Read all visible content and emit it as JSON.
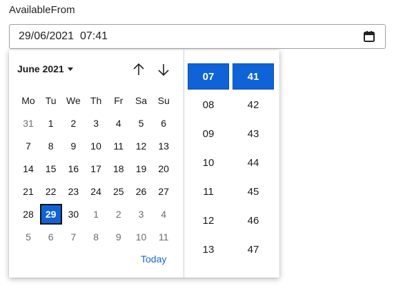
{
  "field": {
    "label": "AvailableFrom",
    "value": "29/06/2021  07:41",
    "calendar_icon": "calendar-icon"
  },
  "calendar": {
    "month_label": "June 2021",
    "nav_up_icon": "arrow-up-icon",
    "nav_down_icon": "arrow-down-icon",
    "weekdays": [
      "Mo",
      "Tu",
      "We",
      "Th",
      "Fr",
      "Sa",
      "Su"
    ],
    "weeks": [
      [
        "31",
        "1",
        "2",
        "3",
        "4",
        "5",
        "6"
      ],
      [
        "7",
        "8",
        "9",
        "10",
        "11",
        "12",
        "13"
      ],
      [
        "14",
        "15",
        "16",
        "17",
        "18",
        "19",
        "20"
      ],
      [
        "21",
        "22",
        "23",
        "24",
        "25",
        "26",
        "27"
      ],
      [
        "28",
        "29",
        "30",
        "1",
        "2",
        "3",
        "4"
      ],
      [
        "5",
        "6",
        "7",
        "8",
        "9",
        "10",
        "11"
      ]
    ],
    "selected_day": "29",
    "today_label": "Today"
  },
  "time": {
    "hours": [
      "07",
      "08",
      "09",
      "10",
      "11",
      "12",
      "13"
    ],
    "minutes": [
      "41",
      "42",
      "43",
      "44",
      "45",
      "46",
      "47"
    ],
    "selected_hour": "07",
    "selected_minute": "41"
  },
  "colors": {
    "accent": "#0f63d6",
    "link": "#1a63c7"
  }
}
